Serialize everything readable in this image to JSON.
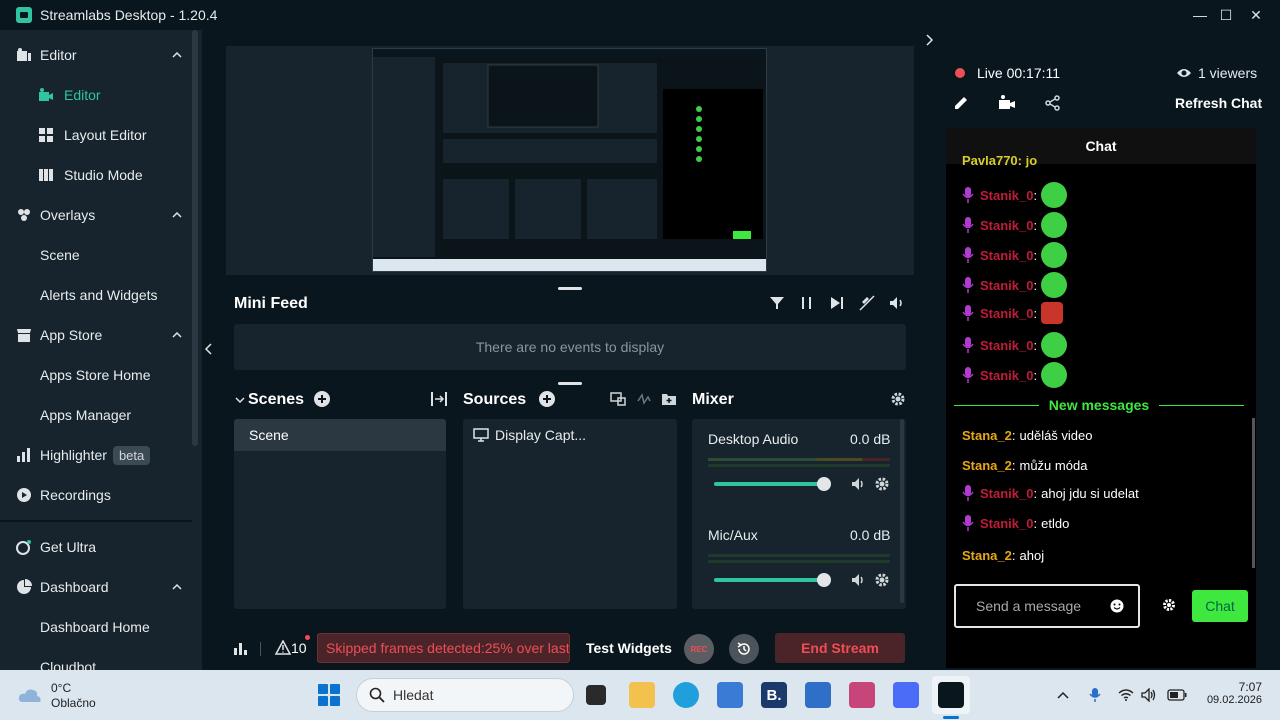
{
  "window": {
    "title": "Streamlabs Desktop - 1.20.4",
    "minimize": "—",
    "maximize": "☐",
    "close": "✕"
  },
  "sidebar": {
    "editor": {
      "label": "Editor"
    },
    "editor_sub": {
      "label": "Editor"
    },
    "layout_editor": {
      "label": "Layout Editor"
    },
    "studio_mode": {
      "label": "Studio Mode"
    },
    "overlays": {
      "label": "Overlays"
    },
    "scene": {
      "label": "Scene"
    },
    "alerts_widgets": {
      "label": "Alerts and Widgets"
    },
    "app_store": {
      "label": "App Store"
    },
    "apps_store_home": {
      "label": "Apps Store Home"
    },
    "apps_manager": {
      "label": "Apps Manager"
    },
    "highlighter": {
      "label": "Highlighter",
      "badge": "beta"
    },
    "recordings": {
      "label": "Recordings"
    },
    "get_ultra": {
      "label": "Get Ultra"
    },
    "dashboard": {
      "label": "Dashboard"
    },
    "dashboard_home": {
      "label": "Dashboard Home"
    },
    "cloudbot": {
      "label": "Cloudbot"
    }
  },
  "mini_feed": {
    "title": "Mini Feed",
    "empty": "There are no events to display"
  },
  "scenes": {
    "title": "Scenes",
    "items": [
      "Scene"
    ]
  },
  "sources": {
    "title": "Sources",
    "items": [
      "Display Capt..."
    ]
  },
  "mixer": {
    "title": "Mixer",
    "channels": [
      {
        "name": "Desktop Audio",
        "db": "0.0 dB",
        "level": 0.82
      },
      {
        "name": "Mic/Aux",
        "db": "0.0 dB",
        "level": 0.82
      }
    ]
  },
  "footer": {
    "warnings": "10",
    "warning_text": "Skipped frames detected:25% over last",
    "test_widgets": "Test Widgets",
    "rec": "REC",
    "end_stream": "End Stream"
  },
  "live": {
    "label": "Live",
    "timer": "00:17:11",
    "viewers": "1 viewers",
    "refresh": "Refresh Chat"
  },
  "chat": {
    "header": "Chat",
    "partial_top": "Pavla770: jo",
    "emote_user": "Stanik_0",
    "new_messages": "New messages",
    "messages": [
      {
        "user": "Stana_2",
        "text": "uděláš video"
      },
      {
        "user": "Stana_2",
        "text": "můžu móda"
      },
      {
        "user": "Stanik_0",
        "text": "ahoj jdu si udelat"
      },
      {
        "user": "Stanik_0",
        "text": "etldo"
      },
      {
        "user": "Stana_2",
        "text": "ahoj"
      }
    ],
    "placeholder": "Send a message",
    "send": "Chat"
  },
  "taskbar": {
    "temp": "0°C",
    "condition": "Oblačno",
    "search": "Hledat",
    "time": "7:07",
    "date": "09.02.2026"
  },
  "colors": {
    "accent": "#31c3a2",
    "danger": "#f04e56",
    "chat_green": "#3ee83e"
  }
}
